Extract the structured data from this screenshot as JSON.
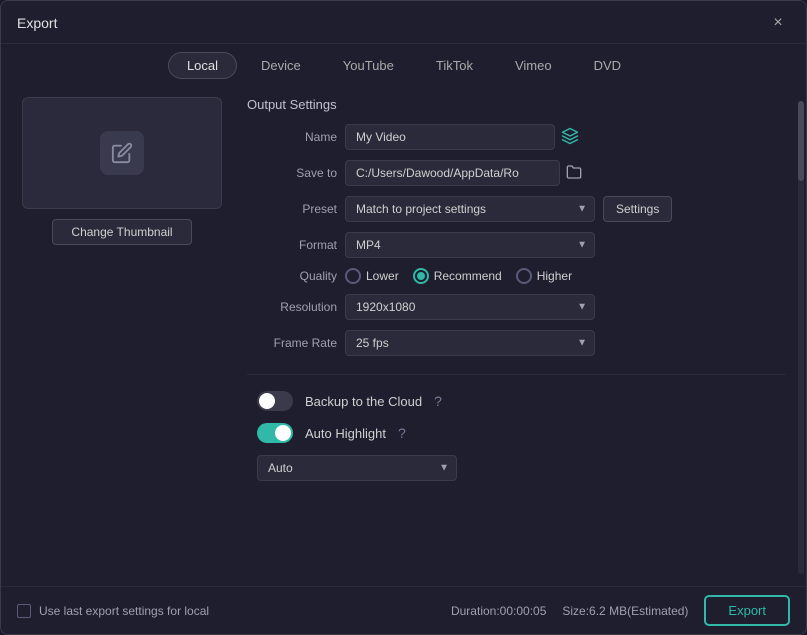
{
  "dialog": {
    "title": "Export",
    "close_label": "×"
  },
  "tabs": [
    {
      "id": "local",
      "label": "Local",
      "active": true
    },
    {
      "id": "device",
      "label": "Device",
      "active": false
    },
    {
      "id": "youtube",
      "label": "YouTube",
      "active": false
    },
    {
      "id": "tiktok",
      "label": "TikTok",
      "active": false
    },
    {
      "id": "vimeo",
      "label": "Vimeo",
      "active": false
    },
    {
      "id": "dvd",
      "label": "DVD",
      "active": false
    }
  ],
  "thumbnail": {
    "change_label": "Change Thumbnail"
  },
  "output_settings": {
    "section_title": "Output Settings",
    "name_label": "Name",
    "name_value": "My Video",
    "save_to_label": "Save to",
    "save_to_value": "C:/Users/Dawood/AppData/Ro",
    "preset_label": "Preset",
    "preset_value": "Match to project settings",
    "settings_btn": "Settings",
    "format_label": "Format",
    "format_value": "MP4",
    "quality_label": "Quality",
    "quality_options": [
      {
        "id": "lower",
        "label": "Lower",
        "checked": false
      },
      {
        "id": "recommend",
        "label": "Recommend",
        "checked": true
      },
      {
        "id": "higher",
        "label": "Higher",
        "checked": false
      }
    ],
    "resolution_label": "Resolution",
    "resolution_value": "1920x1080",
    "frame_rate_label": "Frame Rate",
    "frame_rate_value": "25 fps"
  },
  "toggles": {
    "backup_label": "Backup to the Cloud",
    "backup_on": false,
    "auto_highlight_label": "Auto Highlight",
    "auto_highlight_on": true,
    "auto_value": "Auto"
  },
  "footer": {
    "checkbox_label": "Use last export settings for local",
    "duration_label": "Duration:00:00:05",
    "size_label": "Size:6.2 MB(Estimated)",
    "export_label": "Export"
  }
}
